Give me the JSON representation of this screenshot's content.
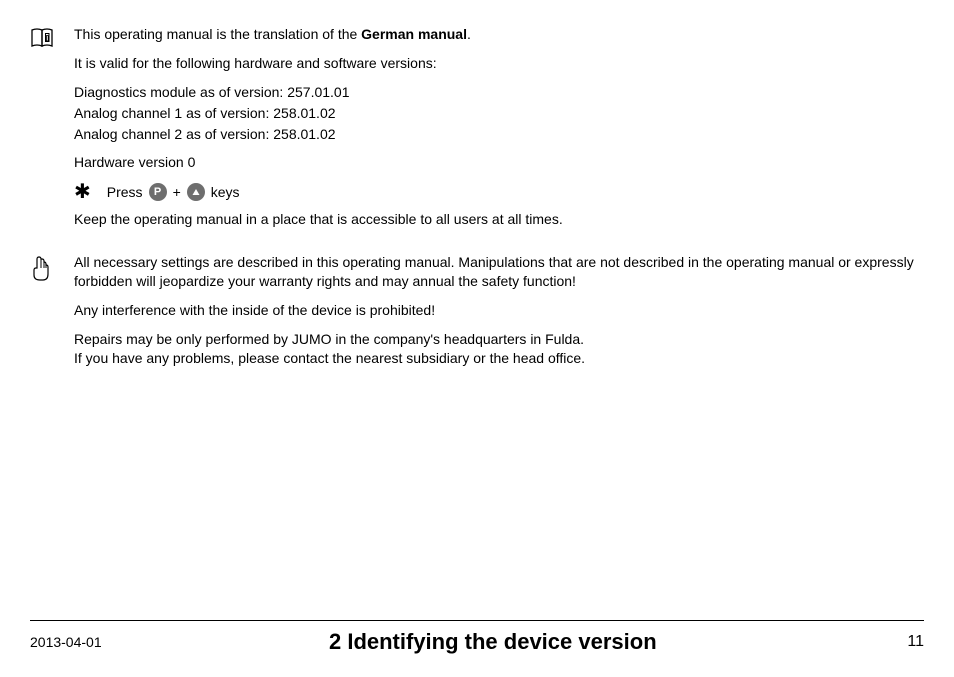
{
  "section1": {
    "p1_pre": "This operating manual is the translation of the ",
    "p1_bold": "German manual",
    "p1_post": ".",
    "p2": "It is valid for the following hardware and software versions:",
    "v1": "Diagnostics module as of version: 257.01.01",
    "v2": "Analog channel 1 as of version:   258.01.02",
    "v3": "Analog channel 2 as of version:  258.01.02",
    "hw": "Hardware version 0",
    "press_pre": "Press",
    "press_plus": "+",
    "press_post": "keys",
    "keep": "Keep the operating manual in a place that is accessible to all users at all times."
  },
  "section2": {
    "p1": "All necessary settings are described in this operating manual. Manipulations that are not described in the operating manual or expressly forbidden will jeopardize your warranty rights and may annual the safety function!",
    "p2": "Any interference with the inside of the device is prohibited!",
    "p3a": "Repairs may be only performed by JUMO in the company's headquarters in Fulda.",
    "p3b": "If you have any problems, please contact the nearest subsidiary or the head office."
  },
  "footer": {
    "date": "2013-04-01",
    "title": "2 Identifying the device version",
    "page": "11"
  }
}
